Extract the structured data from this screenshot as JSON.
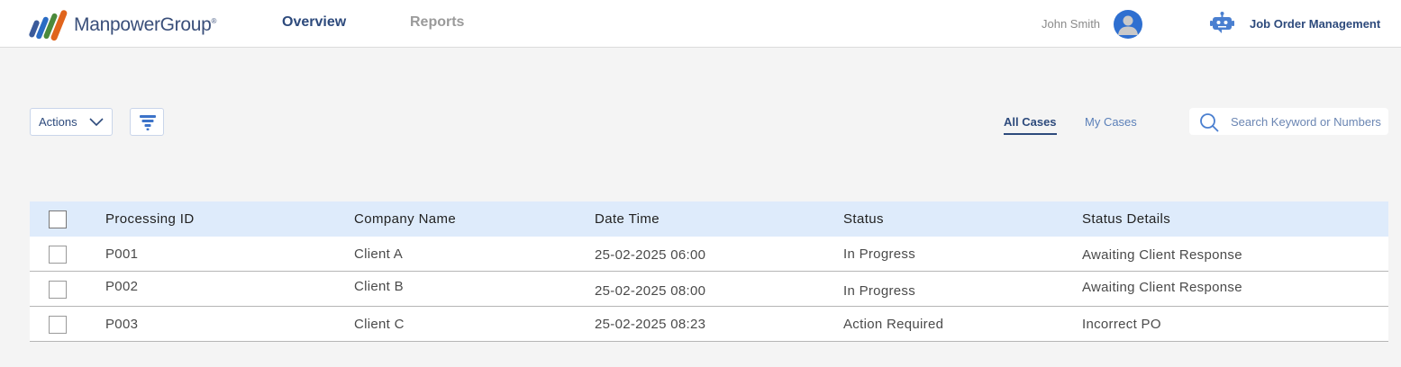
{
  "brand": {
    "name": "ManpowerGroup",
    "mark": "®"
  },
  "nav": {
    "tabs": [
      {
        "label": "Overview",
        "active": true
      },
      {
        "label": "Reports",
        "active": false
      }
    ]
  },
  "user": {
    "name": "John Smith",
    "avatar_icon": "user-avatar-icon"
  },
  "app": {
    "icon": "robot-icon",
    "label": "Job Order Management"
  },
  "toolbar": {
    "actions_label": "Actions",
    "filter_icon": "funnel-filter-icon"
  },
  "case_tabs": [
    {
      "label": "All Cases",
      "active": true
    },
    {
      "label": "My Cases",
      "active": false
    }
  ],
  "search": {
    "placeholder": "Search Keyword or Numbers",
    "value": ""
  },
  "table": {
    "columns": [
      "Processing ID",
      "Company Name",
      "Date Time",
      "Status",
      "Status Details"
    ],
    "rows": [
      {
        "id": "P001",
        "company": "Client A",
        "datetime": "25-02-2025 06:00",
        "status": "In Progress",
        "details": "Awaiting Client Response"
      },
      {
        "id": "P002",
        "company": "Client B",
        "datetime": "25-02-2025 08:00",
        "status": "In Progress",
        "details": "Awaiting Client Response"
      },
      {
        "id": "P003",
        "company": "Client C",
        "datetime": "25-02-2025 08:23",
        "status": "Action Required",
        "details": "Incorrect PO"
      }
    ]
  },
  "colors": {
    "primary": "#2d4a7c",
    "header_bg": "#deebfb",
    "accent_blue": "#2e6fd0",
    "page_bg": "#f4f4f4"
  }
}
